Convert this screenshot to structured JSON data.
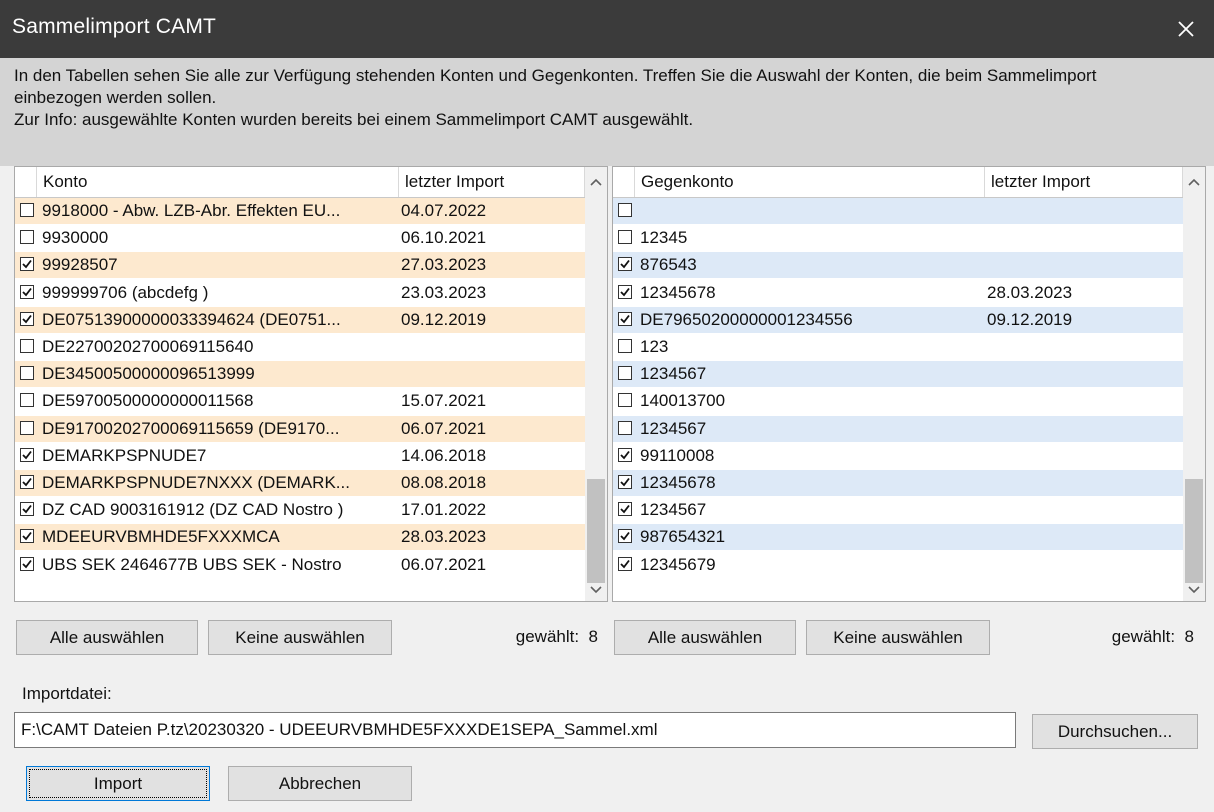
{
  "window": {
    "title": "Sammelimport  CAMT",
    "close_symbol": "×"
  },
  "info": {
    "line1": "In den Tabellen sehen Sie alle zur Verfügung stehenden Konten und Gegenkonten. Treffen Sie die Auswahl der Konten, die beim Sammelimport",
    "line2": "einbezogen werden sollen.",
    "line3": "Zur Info: ausgewählte Konten wurden bereits bei einem Sammelimport  CAMT ausgewählt."
  },
  "colors": {
    "left_highlight": "#fde9cf",
    "right_highlight": "#dde9f7"
  },
  "left_table": {
    "col_account": "Konto",
    "col_last_import": "letzter Import",
    "rows": [
      {
        "checked": false,
        "account": "9918000 - Abw. LZB-Abr. Effekten EU...",
        "date": "04.07.2022",
        "highlight": true
      },
      {
        "checked": false,
        "account": "9930000",
        "date": "06.10.2021",
        "highlight": false
      },
      {
        "checked": true,
        "account": "99928507",
        "date": "27.03.2023",
        "highlight": true
      },
      {
        "checked": true,
        "account": "999999706 (abcdefg )",
        "date": "23.03.2023",
        "highlight": false
      },
      {
        "checked": true,
        "account": "DE07513900000033394624 (DE0751...",
        "date": "09.12.2019",
        "highlight": true
      },
      {
        "checked": false,
        "account": "DE22700202700069115640",
        "date": "",
        "highlight": false
      },
      {
        "checked": false,
        "account": "DE34500500000096513999",
        "date": "",
        "highlight": true
      },
      {
        "checked": false,
        "account": "DE59700500000000011568",
        "date": "15.07.2021",
        "highlight": false
      },
      {
        "checked": false,
        "account": "DE91700202700069115659 (DE9170...",
        "date": "06.07.2021",
        "highlight": true
      },
      {
        "checked": true,
        "account": "DEMARKPSPNUDE7",
        "date": "14.06.2018",
        "highlight": false
      },
      {
        "checked": true,
        "account": "DEMARKPSPNUDE7NXXX (DEMARK...",
        "date": "08.08.2018",
        "highlight": true
      },
      {
        "checked": true,
        "account": "DZ CAD 9003161912 (DZ CAD Nostro )",
        "date": "17.01.2022",
        "highlight": false
      },
      {
        "checked": true,
        "account": "MDEEURVBMHDE5FXXXMCA",
        "date": "28.03.2023",
        "highlight": true
      },
      {
        "checked": true,
        "account": "UBS SEK 2464677B UBS SEK - Nostro",
        "date": "06.07.2021",
        "highlight": false
      }
    ]
  },
  "right_table": {
    "col_account": "Gegenkonto",
    "col_last_import": "letzter Import",
    "rows": [
      {
        "checked": false,
        "account": "",
        "date": "",
        "highlight": true
      },
      {
        "checked": false,
        "account": "12345",
        "date": "",
        "highlight": false
      },
      {
        "checked": true,
        "account": "876543",
        "date": "",
        "highlight": true
      },
      {
        "checked": true,
        "account": "12345678",
        "date": "28.03.2023",
        "highlight": false
      },
      {
        "checked": true,
        "account": "DE79650200000001234556",
        "date": "09.12.2019",
        "highlight": true
      },
      {
        "checked": false,
        "account": "123",
        "date": "",
        "highlight": false
      },
      {
        "checked": false,
        "account": "1234567",
        "date": "",
        "highlight": true
      },
      {
        "checked": false,
        "account": "140013700",
        "date": "",
        "highlight": false
      },
      {
        "checked": false,
        "account": "1234567",
        "date": "",
        "highlight": true
      },
      {
        "checked": true,
        "account": "99110008",
        "date": "",
        "highlight": false
      },
      {
        "checked": true,
        "account": "12345678",
        "date": "",
        "highlight": true
      },
      {
        "checked": true,
        "account": "1234567",
        "date": "",
        "highlight": false
      },
      {
        "checked": true,
        "account": "987654321",
        "date": "",
        "highlight": true
      },
      {
        "checked": true,
        "account": "12345679",
        "date": "",
        "highlight": false
      }
    ]
  },
  "buttons": {
    "select_all": "Alle auswählen",
    "select_none": "Keine auswählen",
    "browse": "Durchsuchen...",
    "import": "Import",
    "cancel": "Abbrechen"
  },
  "left_selected_count": "gewählt:  8",
  "right_selected_count": "gewählt:  8",
  "import_file": {
    "label": "Importdatei:",
    "path": "F:\\CAMT Dateien P.tz\\20230320 - UDEEURVBMHDE5FXXXDE1SEPA_Sammel.xml"
  }
}
